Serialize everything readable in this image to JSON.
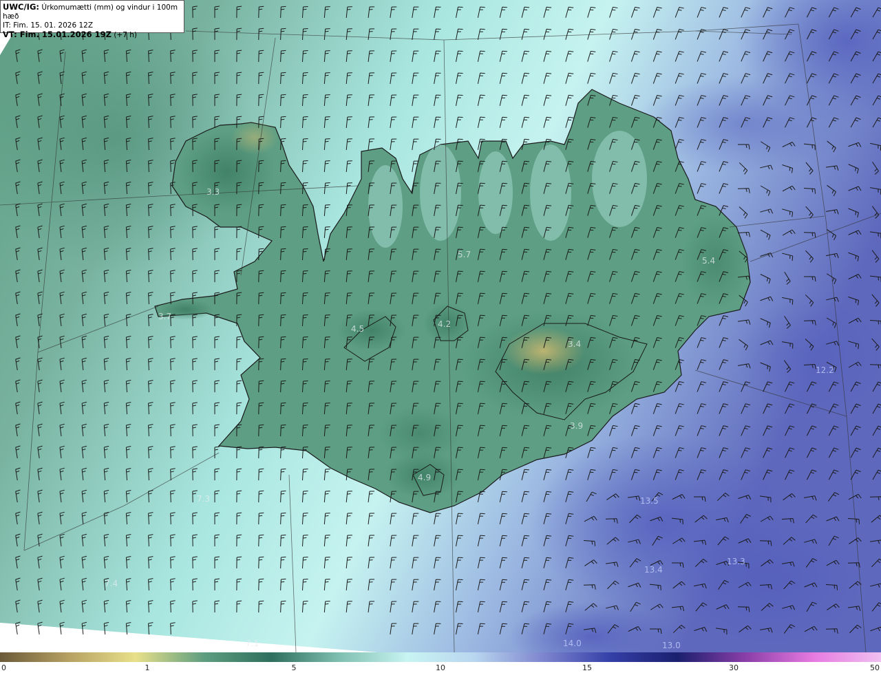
{
  "title": {
    "model": "UWC/IG:",
    "description": "Úrkomumætti (mm) og vindur i 100m hæð",
    "it_line": "IT: Fim. 15. 01. 2026 12Z",
    "vt_bold": "VT: Fim. 15.01.2026 19Z",
    "vt_suffix": "(+7 h)"
  },
  "colorbar": {
    "ticks": [
      "0",
      "1",
      "5",
      "10",
      "15",
      "30",
      "50"
    ],
    "colors": [
      "#6b5a3a",
      "#b5a062",
      "#e8e08a",
      "#5f9e80",
      "#2f6f5d",
      "#7fbfb0",
      "#c8f4f2",
      "#b9d6ef",
      "#7f87cf",
      "#3540a8",
      "#1a1f6e",
      "#8a3ea8",
      "#e67ae0",
      "#f0c0f0"
    ]
  },
  "map_values": [
    {
      "text": "3.3",
      "tone": "land"
    },
    {
      "text": "5.7",
      "tone": "land"
    },
    {
      "text": "5.4",
      "tone": "land"
    },
    {
      "text": "3.7",
      "tone": "land"
    },
    {
      "text": "4.5",
      "tone": "land"
    },
    {
      "text": "4.2",
      "tone": "land"
    },
    {
      "text": "3.4",
      "tone": "land"
    },
    {
      "text": "3.9",
      "tone": "land"
    },
    {
      "text": "4.9",
      "tone": "land"
    },
    {
      "text": "12.2",
      "tone": "sea"
    },
    {
      "text": "7.3",
      "tone": "land"
    },
    {
      "text": "13.5",
      "tone": "sea"
    },
    {
      "text": "13.4",
      "tone": "sea"
    },
    {
      "text": "13.3",
      "tone": "sea"
    },
    {
      "text": "7.4",
      "tone": "land"
    },
    {
      "text": "7.1",
      "tone": "land"
    },
    {
      "text": "14.0",
      "tone": "sea"
    },
    {
      "text": "13.0",
      "tone": "sea"
    }
  ]
}
